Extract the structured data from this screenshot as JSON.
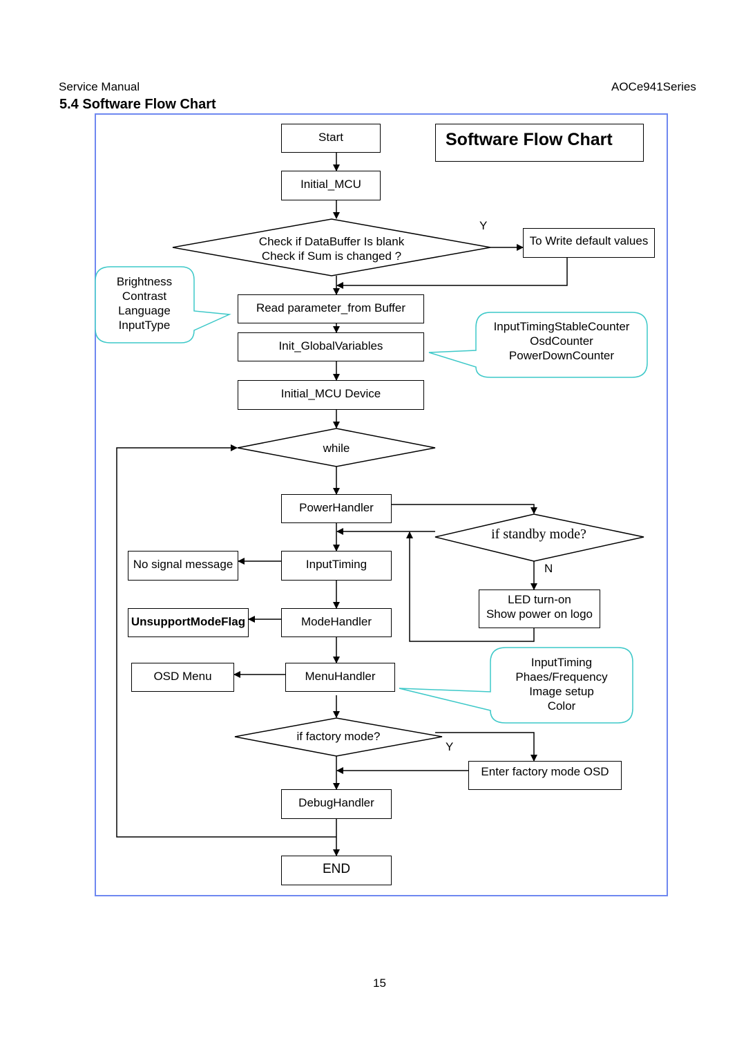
{
  "header": {
    "left": "Service Manual",
    "right": "AOCe941Series"
  },
  "section_title": "5.4 Software Flow Chart",
  "chart_title": "Software Flow Chart",
  "nodes": {
    "start": "Start",
    "initial_mcu": "Initial_MCU",
    "check_buffer_line1": "Check if DataBuffer Is blank",
    "check_buffer_line2": "Check if Sum is changed ?",
    "write_defaults": "To Write default values",
    "read_param": "Read parameter_from Buffer",
    "init_globals": "Init_GlobalVariables",
    "initial_mcu_device": "Initial_MCU Device",
    "while": "while",
    "power_handler": "PowerHandler",
    "if_standby": "if standby mode?",
    "led_line1": "LED turn-on",
    "led_line2": "Show power on logo",
    "input_timing": "InputTiming",
    "no_signal": "No signal message",
    "mode_handler": "ModeHandler",
    "unsupport_flag": "UnsupportModeFlag",
    "menu_handler": "MenuHandler",
    "osd_menu": "OSD Menu",
    "if_factory": "if factory mode?",
    "enter_factory": "Enter factory mode OSD",
    "debug_handler": "DebugHandler",
    "end": "END"
  },
  "branch_labels": {
    "check_yes": "Y",
    "standby_no": "N",
    "factory_yes": "Y"
  },
  "callouts": {
    "buffer_params": [
      "Brightness",
      "Contrast",
      "Language",
      "InputType"
    ],
    "global_vars": [
      "InputTimingStableCounter",
      "OsdCounter",
      "PowerDownCounter"
    ],
    "menu_items": [
      "InputTiming",
      "Phaes/Frequency",
      "Image setup",
      "Color"
    ]
  },
  "colors": {
    "frame_border": "#6e87f0",
    "callout_border": "#3cc8c8",
    "line": "#000000"
  },
  "page_number": "15"
}
